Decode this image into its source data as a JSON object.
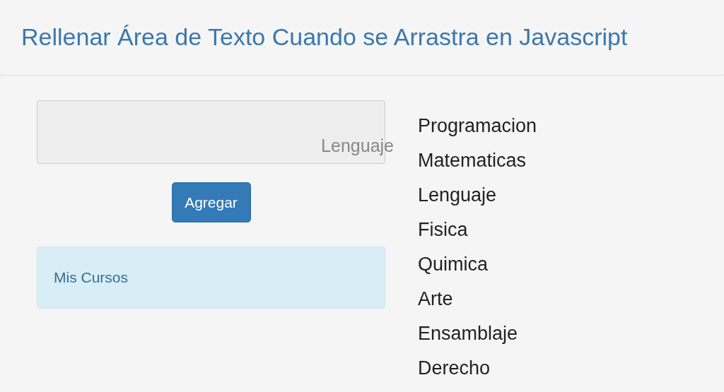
{
  "title": "Rellenar Área de Texto Cuando se Arrastra en Javascript",
  "drop_area": {
    "dragged_text": "Lenguaje"
  },
  "button": {
    "label": "Agregar"
  },
  "info_box": {
    "text": "Mis Cursos"
  },
  "courses": [
    {
      "label": "Programacion"
    },
    {
      "label": "Matematicas"
    },
    {
      "label": "Lenguaje"
    },
    {
      "label": "Fisica"
    },
    {
      "label": "Quimica"
    },
    {
      "label": "Arte"
    },
    {
      "label": "Ensamblaje"
    },
    {
      "label": "Derecho"
    }
  ]
}
